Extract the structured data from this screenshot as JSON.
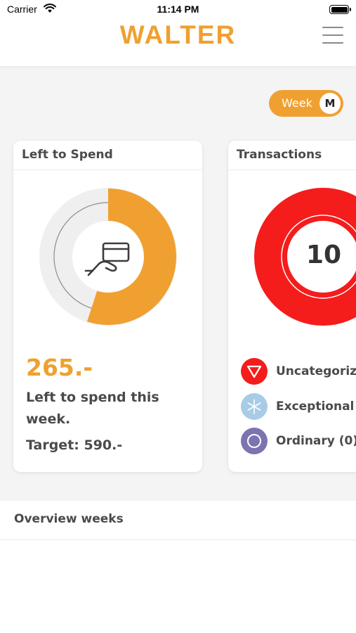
{
  "status_bar": {
    "carrier": "Carrier",
    "time": "11:14 PM"
  },
  "header": {
    "logo": "WALTER"
  },
  "period_toggle": {
    "label": "Week",
    "knob": "M"
  },
  "left_card": {
    "title": "Left to Spend",
    "amount": "265.-",
    "description": "Left to spend this week.",
    "target": "Target: 590.-",
    "spent_fraction": 0.55
  },
  "right_card": {
    "title": "Transactions",
    "count": "10",
    "legend": [
      {
        "label": "Uncategorize",
        "icon": "triangle-down-icon",
        "color": "#f51c1c"
      },
      {
        "label": "Exceptional (",
        "icon": "snowflake-icon",
        "color": "#a8cbe6"
      },
      {
        "label": "Ordinary (0)",
        "icon": "circle-icon",
        "color": "#7b74b0"
      }
    ]
  },
  "overview": {
    "title": "Overview weeks"
  },
  "colors": {
    "accent": "#f0a030",
    "alert": "#f51c1c",
    "background": "#f4f4f4"
  }
}
